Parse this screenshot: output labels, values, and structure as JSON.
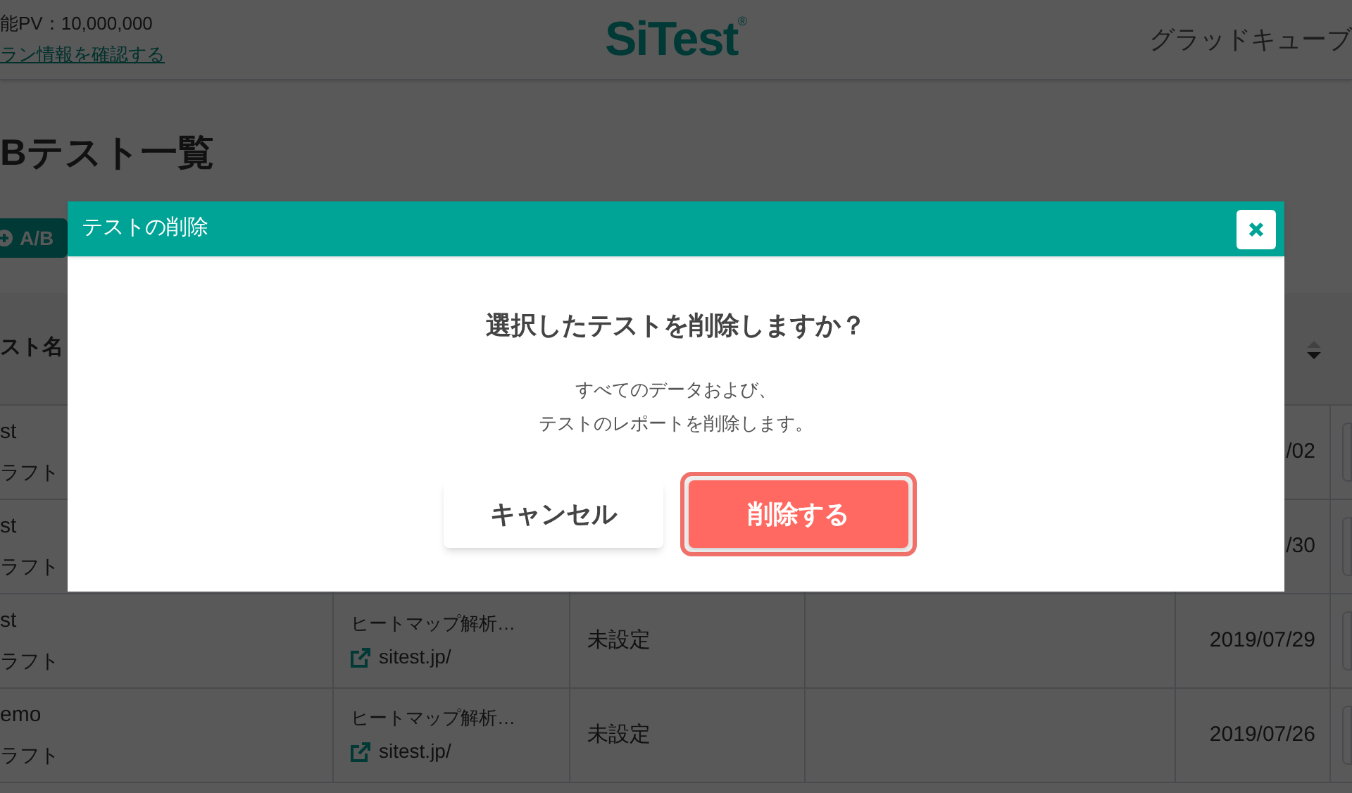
{
  "header": {
    "pv_text": "能PV：10,000,000",
    "plan_link": "ラン情報を確認する",
    "logo": "SiTest",
    "logo_mark": "®",
    "company": "グラッドキューブ"
  },
  "page_title": "Bテスト一覧",
  "add_button": "A/B",
  "table": {
    "columns": [
      "スト名"
    ],
    "rows": [
      {
        "name": "st",
        "status": "ラフト",
        "date": "/02"
      },
      {
        "name": "st",
        "status": "ラフト",
        "date": "/30"
      },
      {
        "name": "st",
        "status": "ラフト",
        "page": "ヒートマップ解析…",
        "url": "sitest.jp/",
        "column_3": "未設定",
        "date": "2019/07/29"
      },
      {
        "name": "emo",
        "status": "ラフト",
        "page": "ヒートマップ解析…",
        "url": "sitest.jp/",
        "column_3": "未設定",
        "date": "2019/07/26"
      }
    ]
  },
  "modal": {
    "title": "テストの削除",
    "heading": "選択したテストを削除しますか？",
    "message": [
      "すべてのデータおよび、",
      "テストのレポートを削除します。"
    ],
    "buttons": [
      {
        "label": "キャンセル",
        "kind": "cancel",
        "focused": false
      },
      {
        "label": "削除する",
        "kind": "danger",
        "focused": true
      }
    ]
  }
}
